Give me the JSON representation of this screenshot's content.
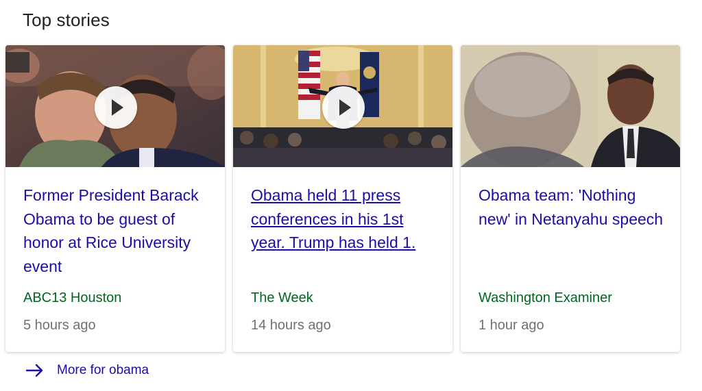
{
  "section_title": "Top stories",
  "stories": [
    {
      "headline": "Former President Barack Obama to be guest of honor at Rice University event",
      "source": "ABC13 Houston",
      "time": "5 hours ago",
      "has_video": true,
      "visited": false
    },
    {
      "headline": "Obama held 11 press conferences in his 1st year. Trump has held 1.",
      "source": "The Week",
      "time": "14 hours ago",
      "has_video": true,
      "visited": true
    },
    {
      "headline": "Obama team: 'Nothing new' in Netanyahu speech",
      "source": "Washington Examiner",
      "time": "1 hour ago",
      "has_video": false,
      "visited": false
    }
  ],
  "more_link": {
    "label": "More for obama",
    "icon": "arrow-right-icon"
  },
  "colors": {
    "link": "#1a0dab",
    "source": "#006621",
    "time": "#707070"
  }
}
